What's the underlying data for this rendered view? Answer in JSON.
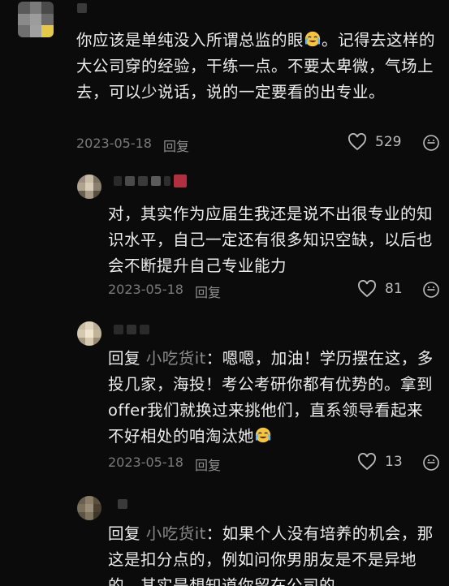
{
  "comments": [
    {
      "text": "你应该是单纯没入所谓总监的眼",
      "text_after_emoji": "。记得去这样的大公司穿的经验，干练一点。不要太卑微，气场上去，可以少说话，说的一定要看的出专业。",
      "emoji": "cry-laugh-emoji",
      "date": "2023-05-18",
      "reply_label": "回复",
      "likes": "529"
    },
    {
      "text": "对，其实作为应届生我还是说不出很专业的知识水平，自己一定还有很多知识空缺，以后也会不断提升自己专业能力",
      "date": "2023-05-18",
      "reply_label": "回复",
      "likes": "81"
    },
    {
      "prefix": "回复",
      "mention": "小吃货it",
      "text": "：嗯嗯，加油！学历摆在这，多投几家，海投！考公考研你都有优势的。拿到offer我们就换过来挑他们，直系领导看起来不好相处的咱淘汰她",
      "emoji": "cry-laugh-emoji",
      "date": "2023-05-18",
      "reply_label": "回复",
      "likes": "13"
    },
    {
      "prefix": "回复",
      "mention": "小吃货it",
      "text": "：如果个人没有培养的机会，那这是扣分点的，例如问你男朋友是不是异地的，其实是想知道你留在公司的"
    }
  ],
  "colors": {
    "background": "#0b0b0b",
    "text": "#ededed",
    "meta": "#7a7a7a"
  }
}
